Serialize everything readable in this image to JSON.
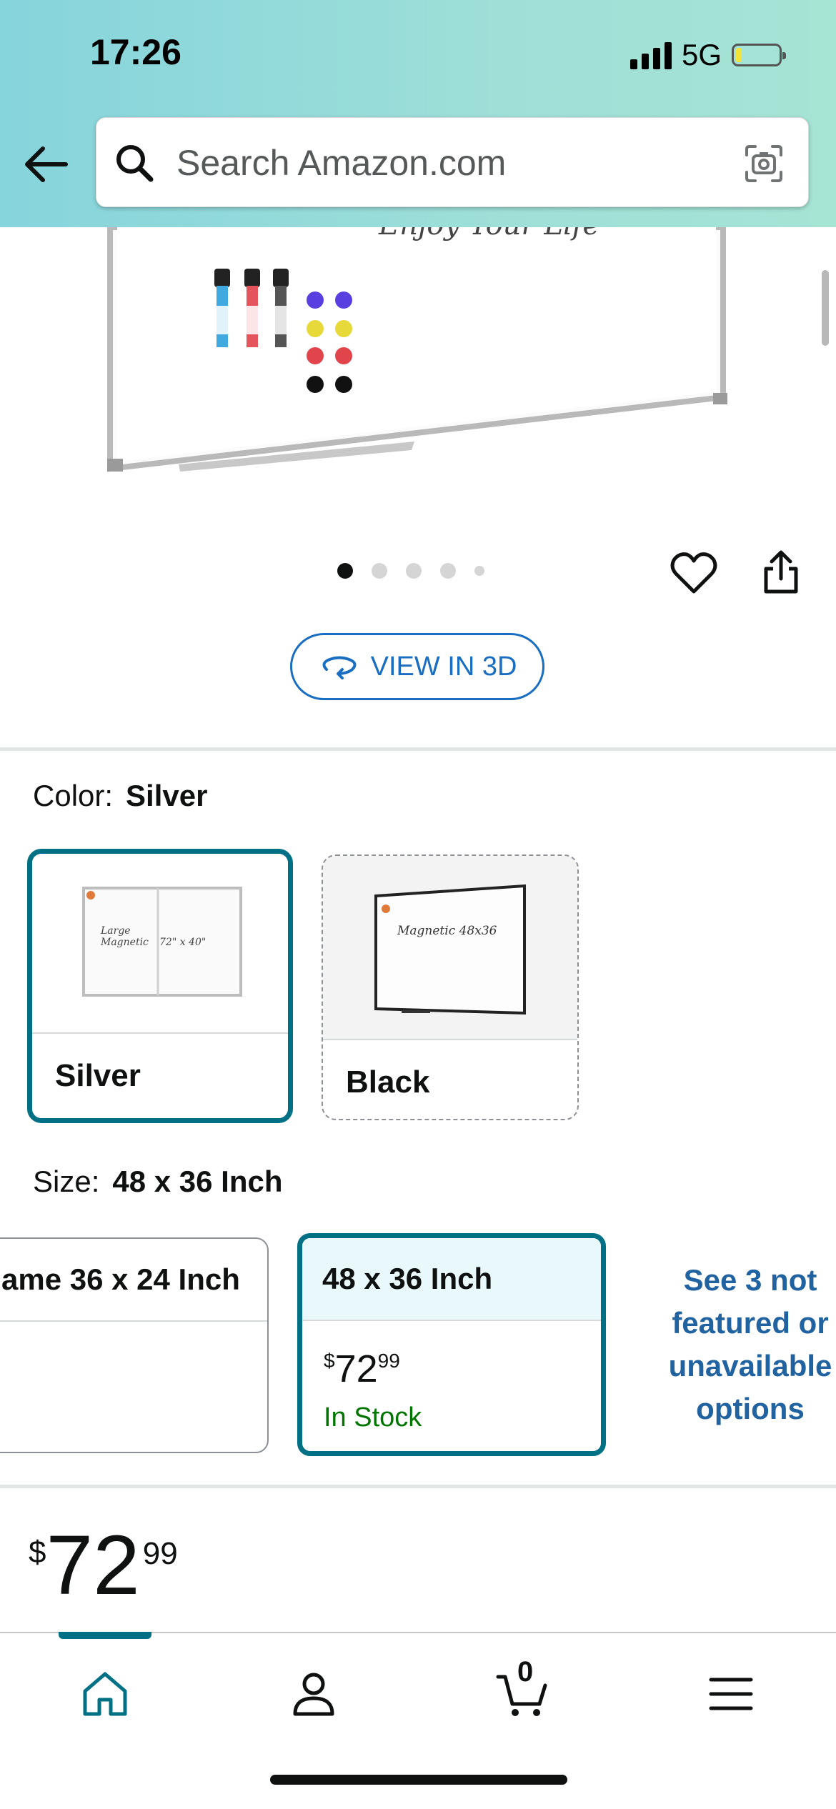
{
  "status_bar": {
    "time": "17:26",
    "network": "5G"
  },
  "search": {
    "placeholder": "Search Amazon.com"
  },
  "gallery": {
    "board_caption": "Enjoy Your Life",
    "dots_count": 5,
    "active_dot": 0,
    "view_3d_label": "VIEW IN 3D"
  },
  "color": {
    "label": "Color:",
    "selected": "Silver",
    "options": [
      {
        "name": "Silver",
        "thumb_text_1": "Large",
        "thumb_text_2": "Magnetic",
        "thumb_text_3": "72\" x 40\""
      },
      {
        "name": "Black",
        "thumb_text_1": "Magnetic 48x36"
      }
    ]
  },
  "size": {
    "label": "Size:",
    "selected": "48 x 36 Inch",
    "options": [
      {
        "name": "ame 36 x 24 Inch"
      },
      {
        "name": "48 x 36 Inch",
        "price_currency": "$",
        "price_whole": "72",
        "price_fraction": "99",
        "availability": "In Stock"
      }
    ],
    "see_more": "See 3 not featured or unavailable options"
  },
  "price": {
    "currency": "$",
    "whole": "72",
    "fraction": "99"
  },
  "tabbar": {
    "cart_count": "0"
  },
  "colors": {
    "accent": "#007185",
    "link": "#2162a1",
    "in_stock": "#007600",
    "view3d": "#1a6ec2"
  }
}
